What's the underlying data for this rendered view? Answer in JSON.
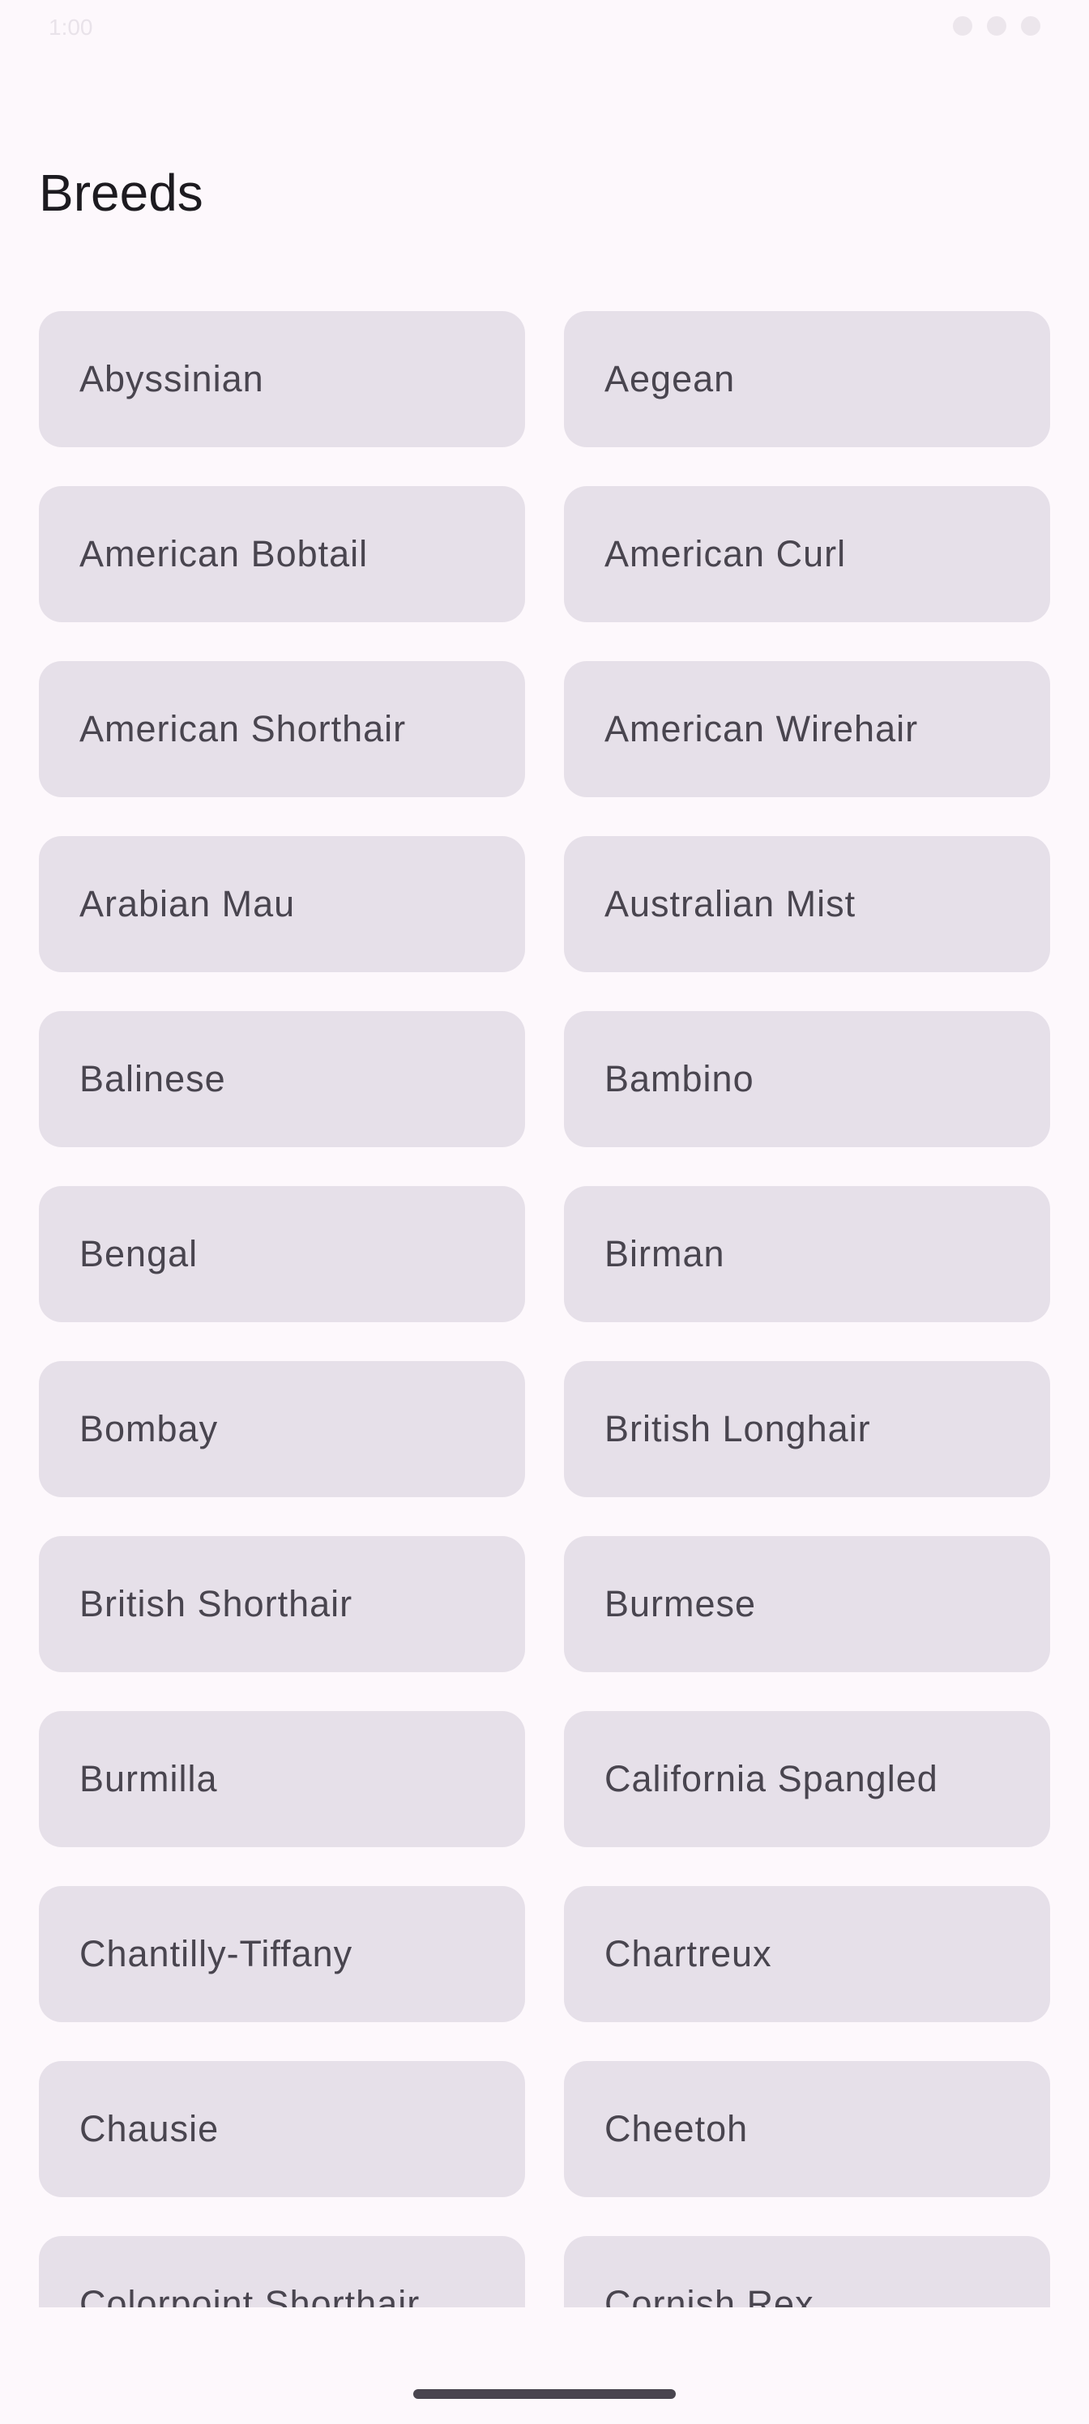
{
  "status_bar": {
    "time": "1:00",
    "icons": [
      "wifi-icon",
      "signal-icon",
      "battery-icon"
    ]
  },
  "header": {
    "title": "Breeds"
  },
  "breeds": [
    "Abyssinian",
    "Aegean",
    "American Bobtail",
    "American Curl",
    "American Shorthair",
    "American Wirehair",
    "Arabian Mau",
    "Australian Mist",
    "Balinese",
    "Bambino",
    "Bengal",
    "Birman",
    "Bombay",
    "British Longhair",
    "British Shorthair",
    "Burmese",
    "Burmilla",
    "California Spangled",
    "Chantilly-Tiffany",
    "Chartreux",
    "Chausie",
    "Cheetoh",
    "Colorpoint Shorthair",
    "Cornish Rex"
  ],
  "colors": {
    "background": "#fdf8fc",
    "card": "#e6e0e9",
    "card_text": "#49454f",
    "title_text": "#1d1b20"
  }
}
